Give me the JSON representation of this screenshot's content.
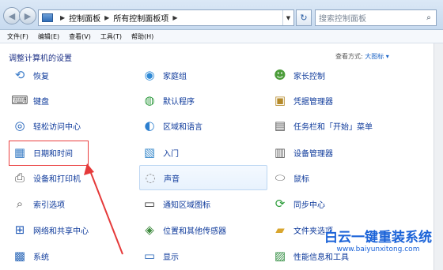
{
  "address": {
    "crumbs": [
      "控制面板",
      "所有控制面板项"
    ],
    "search_placeholder": "搜索控制面板"
  },
  "menu": [
    "文件(F)",
    "编辑(E)",
    "查看(V)",
    "工具(T)",
    "帮助(H)"
  ],
  "heading": "调整计算机的设置",
  "view_by_label": "查看方式:",
  "view_by_value": "大图标",
  "items": [
    {
      "label": "恢复",
      "icon": "recovery-icon"
    },
    {
      "label": "家庭组",
      "icon": "homegroup-icon"
    },
    {
      "label": "家长控制",
      "icon": "parental-controls-icon"
    },
    {
      "label": "键盘",
      "icon": "keyboard-icon"
    },
    {
      "label": "默认程序",
      "icon": "default-programs-icon"
    },
    {
      "label": "凭据管理器",
      "icon": "credential-manager-icon"
    },
    {
      "label": "轻松访问中心",
      "icon": "ease-of-access-icon"
    },
    {
      "label": "区域和语言",
      "icon": "globe-icon"
    },
    {
      "label": "任务栏和「开始」菜单",
      "icon": "taskbar-icon"
    },
    {
      "label": "日期和时间",
      "icon": "calendar-clock-icon"
    },
    {
      "label": "入门",
      "icon": "getting-started-icon"
    },
    {
      "label": "设备管理器",
      "icon": "device-manager-icon"
    },
    {
      "label": "设备和打印机",
      "icon": "printer-icon"
    },
    {
      "label": "声音",
      "icon": "speaker-icon"
    },
    {
      "label": "鼠标",
      "icon": "mouse-icon"
    },
    {
      "label": "索引选项",
      "icon": "indexing-icon"
    },
    {
      "label": "通知区域图标",
      "icon": "notification-icons-icon"
    },
    {
      "label": "同步中心",
      "icon": "sync-icon"
    },
    {
      "label": "网络和共享中心",
      "icon": "network-icon"
    },
    {
      "label": "位置和其他传感器",
      "icon": "sensors-icon"
    },
    {
      "label": "文件夹选项",
      "icon": "folder-options-icon"
    },
    {
      "label": "系统",
      "icon": "system-icon"
    },
    {
      "label": "显示",
      "icon": "display-icon"
    },
    {
      "label": "性能信息和工具",
      "icon": "performance-icon"
    }
  ],
  "watermark": {
    "title": "白云一键重装系统",
    "url": "www.baiyunxitong.com"
  }
}
